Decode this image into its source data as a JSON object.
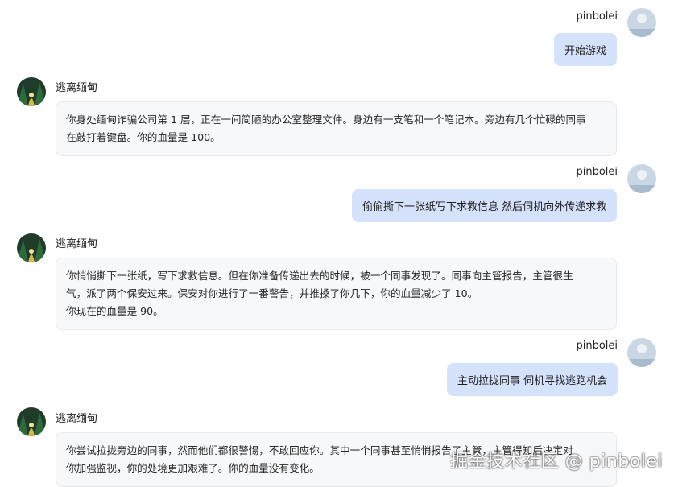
{
  "messages": [
    {
      "role": "user",
      "name": "pinbolei",
      "text": "开始游戏"
    },
    {
      "role": "assistant",
      "name": "逃离缅甸",
      "lines": [
        "你身处缅甸诈骗公司第 1 层，正在一间简陋的办公室整理文件。身边有一支笔和一个笔记本。旁边有几个忙碌的同事",
        "在敲打着键盘。你的血量是 100。"
      ]
    },
    {
      "role": "user",
      "name": "pinbolei",
      "text": "偷偷撕下一张纸写下求救信息 然后伺机向外传递求救"
    },
    {
      "role": "assistant",
      "name": "逃离缅甸",
      "lines": [
        "你悄悄撕下一张纸，写下求救信息。但在你准备传递出去的时候，被一个同事发现了。同事向主管报告，主管很生",
        "气，派了两个保安过来。保安对你进行了一番警告，并推搡了你几下，你的血量减少了 10。",
        "你现在的血量是 90。"
      ]
    },
    {
      "role": "user",
      "name": "pinbolei",
      "text": "主动拉拢同事 伺机寻找逃跑机会"
    },
    {
      "role": "assistant",
      "name": "逃离缅甸",
      "lines": [
        "你尝试拉拢旁边的同事，然而他们都很警惕，不敢回应你。其中一个同事甚至悄悄报告了主管，主管得知后决定对",
        "你加强监视，你的处境更加艰难了。你的血量没有变化。"
      ]
    }
  ],
  "watermark": "掘金技术社区 @ pinbolei",
  "colors": {
    "user_bubble": "#d4e2fb",
    "bot_bubble": "#f7f8fa"
  }
}
